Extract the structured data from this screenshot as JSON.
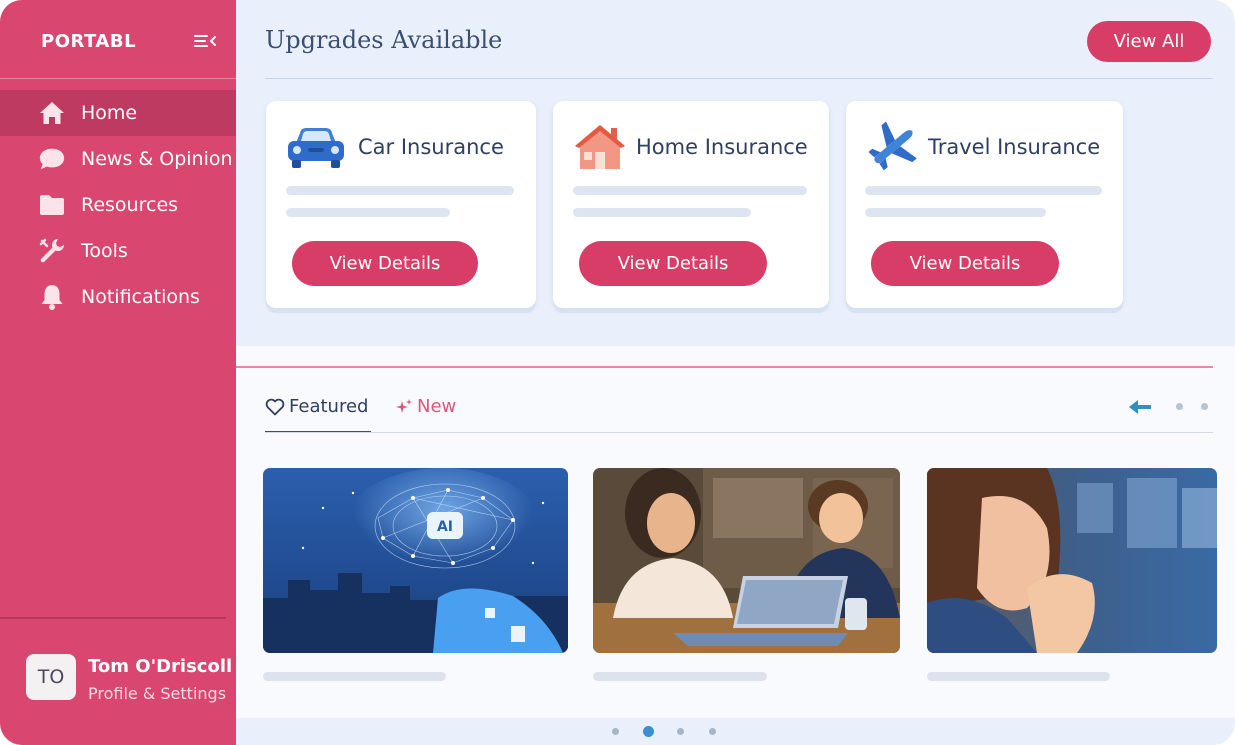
{
  "sidebar": {
    "brand": "PORTABL",
    "items": [
      {
        "label": "Home",
        "icon": "home-icon",
        "active": true
      },
      {
        "label": "News & Opinion",
        "icon": "chat-bubble-icon"
      },
      {
        "label": "Resources",
        "icon": "folder-icon"
      },
      {
        "label": "Tools",
        "icon": "wrench-icon"
      },
      {
        "label": "Notifications",
        "icon": "bell-icon"
      }
    ],
    "user": {
      "initials": "TO",
      "name": "Tom O'Driscoll",
      "sub": "Profile & Settings"
    }
  },
  "upgrades": {
    "title": "Upgrades Available",
    "view_all": "View All",
    "cards": [
      {
        "title": "Car Insurance",
        "icon": "car-icon",
        "button": "View Details"
      },
      {
        "title": "Home Insurance",
        "icon": "house-icon",
        "button": "View Details"
      },
      {
        "title": "Travel Insurance",
        "icon": "airplane-icon",
        "button": "View Details"
      }
    ]
  },
  "featured": {
    "tabs": [
      {
        "label": "Featured",
        "icon": "heart-icon",
        "active": true
      },
      {
        "label": "New",
        "icon": "sparkle-icon"
      }
    ],
    "thumbs": [
      {
        "badge": "AI",
        "subject": "ai-brain-city"
      },
      {
        "subject": "two-people-laptop"
      },
      {
        "subject": "woman-thinking"
      }
    ],
    "carousel_pages": 4,
    "carousel_active": 2
  },
  "colors": {
    "accent": "#d83d67",
    "sidebar": "#d9466f",
    "bg": "#e9f0fb",
    "active_dot": "#3a8fd0"
  }
}
